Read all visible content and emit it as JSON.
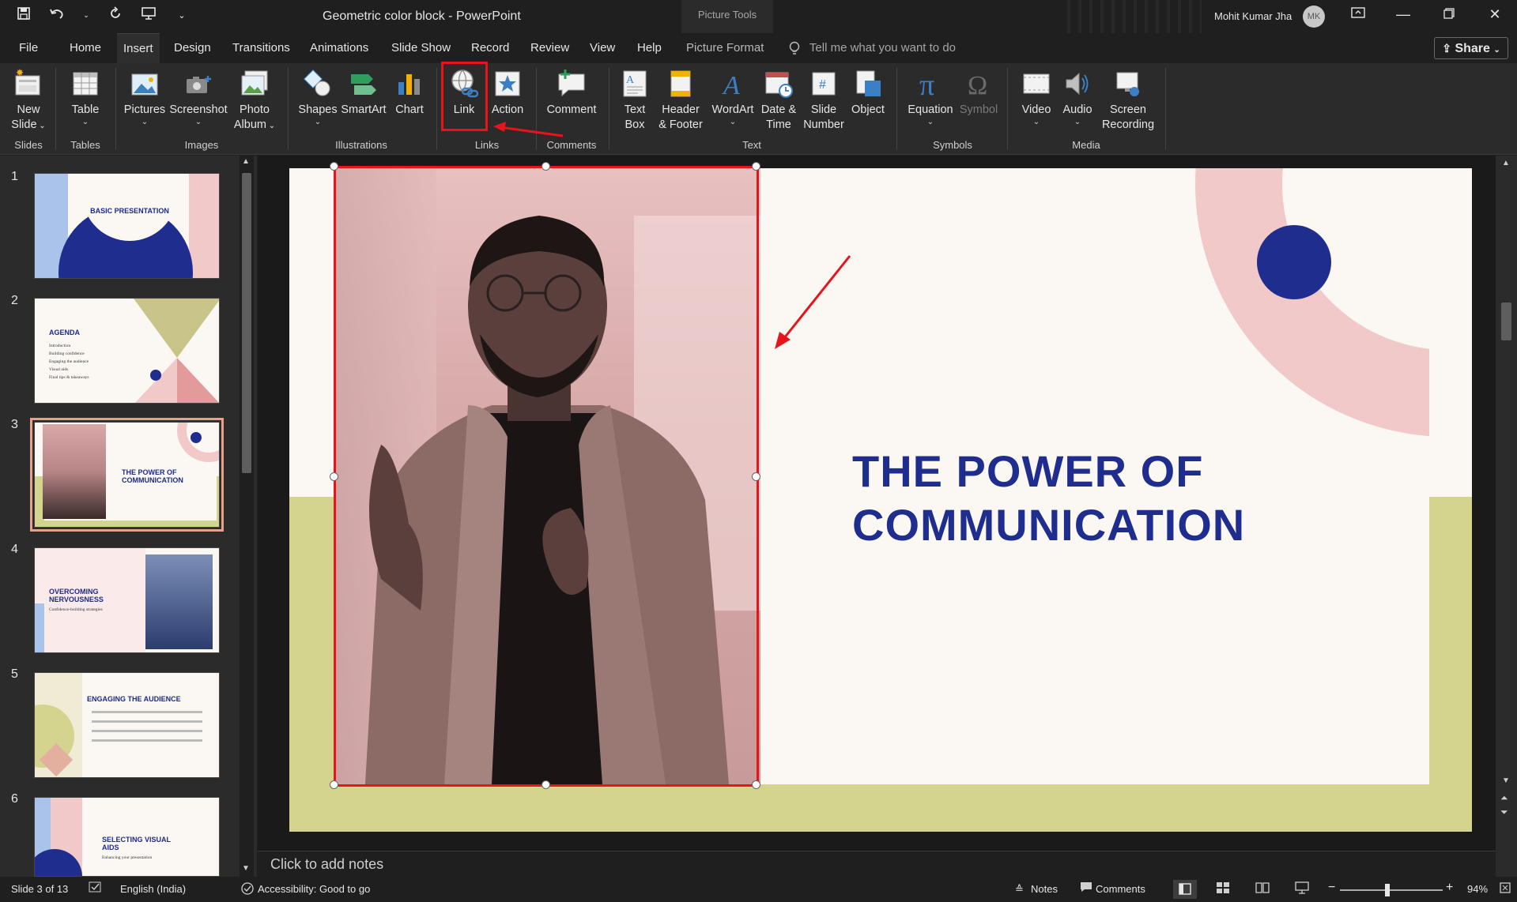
{
  "titlebar": {
    "qat": [
      "save-icon",
      "undo-icon",
      "redo-icon",
      "present-icon",
      "customize-icon"
    ],
    "title": "Geometric color block  -  PowerPoint",
    "context_group": "Picture Tools",
    "user_name": "Mohit Kumar Jha",
    "user_initials": "MK",
    "controls": [
      "ribbon-display-icon",
      "minimize-icon",
      "restore-icon",
      "close-icon"
    ]
  },
  "menu": {
    "items": [
      "File",
      "Home",
      "Insert",
      "Design",
      "Transitions",
      "Animations",
      "Slide Show",
      "Record",
      "Review",
      "View",
      "Help",
      "Picture Format"
    ],
    "active": "Insert",
    "tellme": "Tell me what you want to do",
    "share": "Share"
  },
  "ribbon": {
    "new_slide": [
      "New",
      "Slide"
    ],
    "table": "Table",
    "pictures": "Pictures",
    "screenshot": "Screenshot",
    "photo_album": [
      "Photo",
      "Album"
    ],
    "shapes": "Shapes",
    "smartart": "SmartArt",
    "chart": "Chart",
    "link": "Link",
    "action": "Action",
    "comment": "Comment",
    "text_box": [
      "Text",
      "Box"
    ],
    "header_footer": [
      "Header",
      "& Footer"
    ],
    "wordart": "WordArt",
    "date_time": [
      "Date &",
      "Time"
    ],
    "slide_number": [
      "Slide",
      "Number"
    ],
    "object": "Object",
    "equation": "Equation",
    "symbol": "Symbol",
    "video": "Video",
    "audio": "Audio",
    "screen_recording": [
      "Screen",
      "Recording"
    ],
    "groups": [
      "Slides",
      "Tables",
      "Images",
      "Illustrations",
      "Links",
      "Comments",
      "Text",
      "Symbols",
      "Media"
    ]
  },
  "thumbnails": [
    {
      "num": "1",
      "title": "BASIC PRESENTATION"
    },
    {
      "num": "2",
      "title": "AGENDA",
      "lines": [
        "Introduction",
        "Building confidence",
        "Engaging the audience",
        "Visual aids",
        "Final tips & takeaways"
      ]
    },
    {
      "num": "3",
      "title": "THE POWER OF COMMUNICATION"
    },
    {
      "num": "4",
      "title": "OVERCOMING NERVOUSNESS",
      "sub": "Confidence-building strategies"
    },
    {
      "num": "5",
      "title": "ENGAGING THE AUDIENCE"
    },
    {
      "num": "6",
      "title": "SELECTING VISUAL AIDS",
      "sub": "Enhancing your presentation"
    }
  ],
  "slide": {
    "title_line1": "THE POWER OF",
    "title_line2": "COMMUNICATION"
  },
  "notes": {
    "placeholder": "Click to add notes"
  },
  "status": {
    "slide_of": "Slide 3 of 13",
    "language": "English (India)",
    "accessibility": "Accessibility: Good to go",
    "notes": "Notes",
    "comments": "Comments",
    "zoom": "94%"
  },
  "colors": {
    "navy": "#1f2d8f",
    "pink": "#f2c9c9",
    "olive": "#d4d48f",
    "annotation_red": "#e8141a"
  }
}
